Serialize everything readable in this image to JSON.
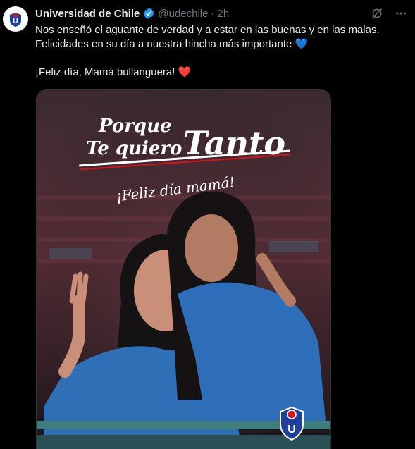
{
  "tweet": {
    "display_name": "Universidad de Chile",
    "handle": "@udechile",
    "separator": "·",
    "time": "2h",
    "text_line1": "Nos enseñó el aguante de verdad y a estar en las buenas y en las malas.",
    "text_line2": "Felicidades en su día a nuestra hincha más importante",
    "text_line3": "¡Feliz día, Mamá bullanguera!",
    "emoji_heart_blue": "💙",
    "emoji_heart_red": "❤️"
  },
  "actions": {
    "grok_icon": "grok-icon",
    "more_icon": "more-icon"
  },
  "media": {
    "poster_line1": "Porque",
    "poster_line2": "Te quiero",
    "poster_line3": "Tanto",
    "poster_line4": "¡Feliz día mamá!",
    "crest_letter": "U"
  },
  "colors": {
    "background": "#000000",
    "text": "#e7e9ea",
    "muted": "#71767b",
    "verified": "#1d9bf0",
    "club_blue": "#1e3f9a",
    "club_red": "#d0161c"
  }
}
